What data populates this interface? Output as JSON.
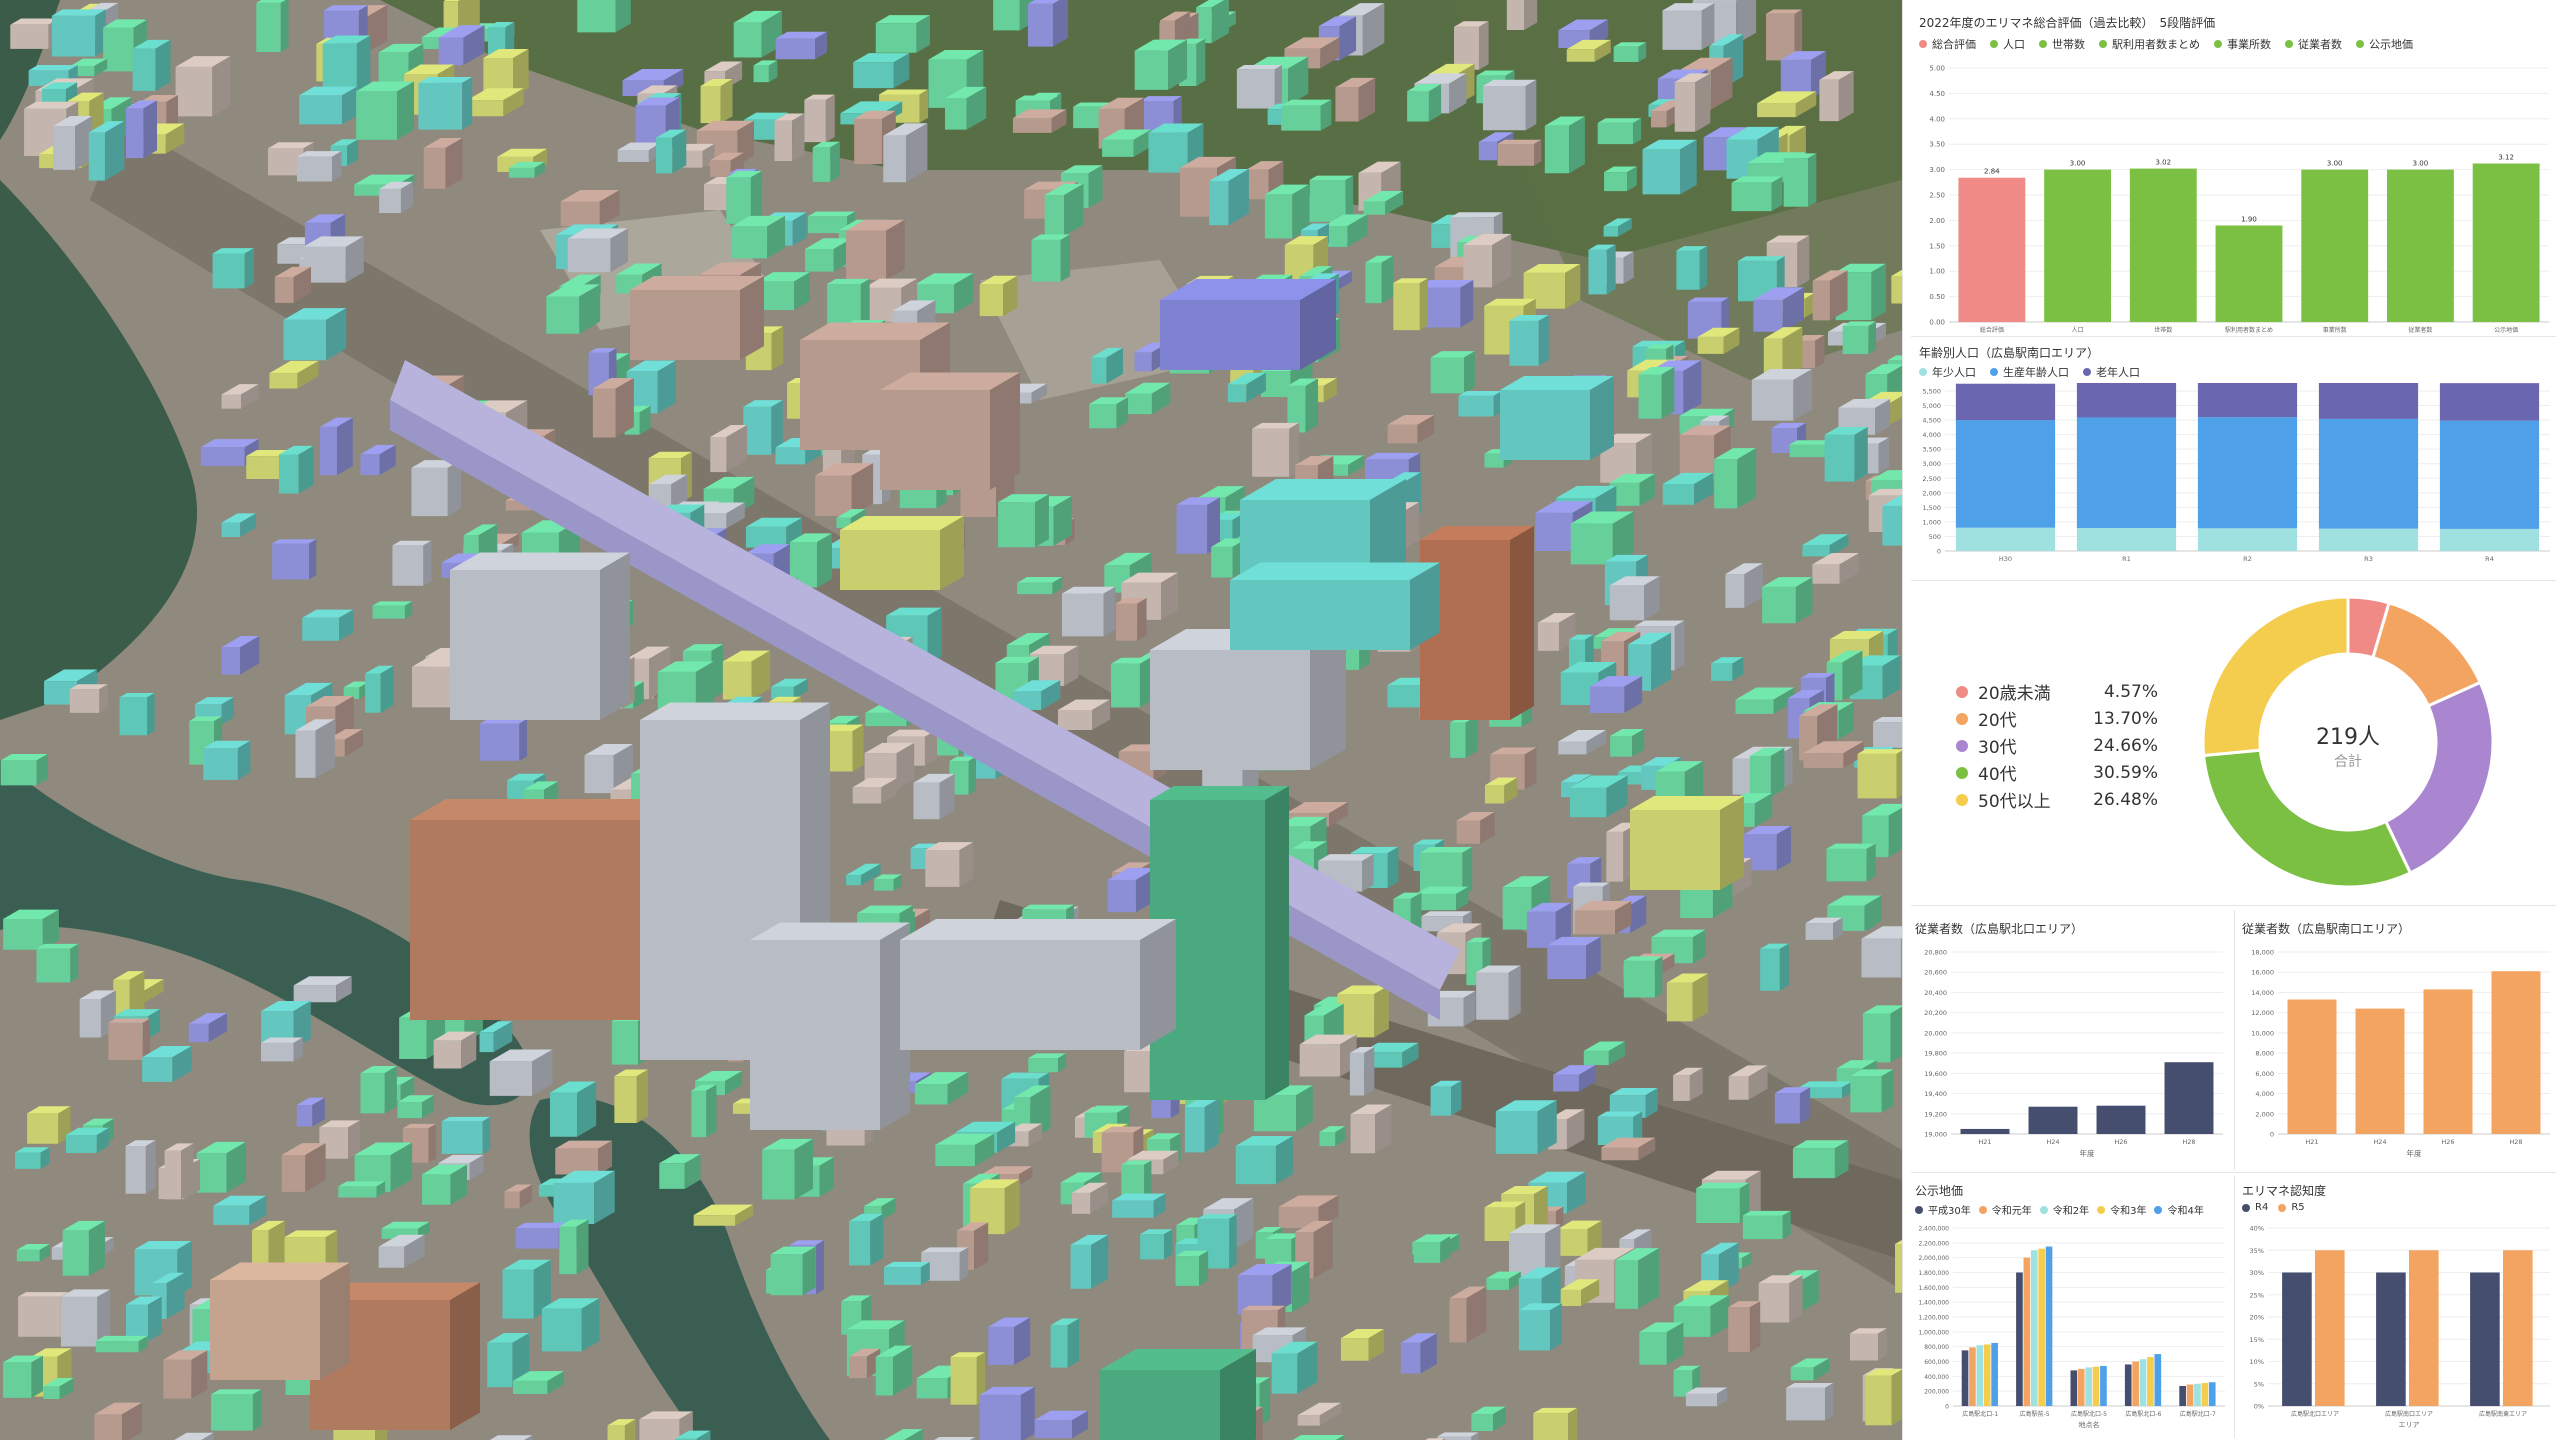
{
  "colors": {
    "green": "#7bc043",
    "salmon": "#ef8a87",
    "darkPurple": "#6a67b0",
    "blue": "#4ea0e8",
    "teal": "#9fe0e0",
    "navy": "#454e6e",
    "orange": "#f4a461",
    "yellow": "#f5cd4e",
    "purple": "#a986cf",
    "pink": "#ef8a87"
  },
  "map": {
    "description_icon": "3d-city-map"
  },
  "panel1": {
    "title": "2022年度のエリマネ総合評価（過去比較）　5段階評価",
    "legend": [
      {
        "label": "総合評価",
        "color": "#ef8a87"
      },
      {
        "label": "人口",
        "color": "#7bc043"
      },
      {
        "label": "世帯数",
        "color": "#7bc043"
      },
      {
        "label": "駅利用者数まとめ",
        "color": "#7bc043"
      },
      {
        "label": "事業所数",
        "color": "#7bc043"
      },
      {
        "label": "従業者数",
        "color": "#7bc043"
      },
      {
        "label": "公示地価",
        "color": "#7bc043"
      }
    ]
  },
  "panel2": {
    "title": "年齢別人口（広島駅南口エリア）",
    "legend": [
      {
        "label": "年少人口",
        "color": "#9fe0e0"
      },
      {
        "label": "生産年齢人口",
        "color": "#4ea0e8"
      },
      {
        "label": "老年人口",
        "color": "#6a67b0"
      }
    ]
  },
  "panel3": {
    "center_value": "219人",
    "center_label": "合計",
    "items": [
      {
        "label": "20歳未満",
        "pct": "4.57%",
        "color": "#ef8a87"
      },
      {
        "label": "20代",
        "pct": "13.70%",
        "color": "#f4a461"
      },
      {
        "label": "30代",
        "pct": "24.66%",
        "color": "#a986cf"
      },
      {
        "label": "40代",
        "pct": "30.59%",
        "color": "#7bc043"
      },
      {
        "label": "50代以上",
        "pct": "26.48%",
        "color": "#f5cd4e"
      }
    ]
  },
  "panel4": {
    "title": "従業者数（広島駅北口エリア）"
  },
  "panel5": {
    "title": "従業者数（広島駅南口エリア）"
  },
  "panel6": {
    "title": "公示地価",
    "legend": [
      {
        "label": "平成30年",
        "color": "#454e6e"
      },
      {
        "label": "令和元年",
        "color": "#f4a461"
      },
      {
        "label": "令和2年",
        "color": "#9fe0e0"
      },
      {
        "label": "令和3年",
        "color": "#f5cd4e"
      },
      {
        "label": "令和4年",
        "color": "#4ea0e8"
      }
    ]
  },
  "panel7": {
    "title": "エリマネ認知度",
    "legend": [
      {
        "label": "R4",
        "color": "#454e6e"
      },
      {
        "label": "R5",
        "color": "#f4a461"
      }
    ]
  },
  "chart_data": [
    {
      "type": "bar",
      "id": "overall-eval",
      "categories": [
        "総合評価",
        "人口",
        "世帯数",
        "駅利用者数まとめ",
        "事業所数",
        "従業者数",
        "公示地価"
      ],
      "values": [
        2.84,
        3.0,
        3.02,
        1.9,
        3.0,
        3.0,
        3.12
      ],
      "value_labels": [
        "2.84",
        "3.00",
        "3.02",
        "1.90",
        "3.00",
        "3.00",
        "3.12"
      ],
      "colors": [
        "#ef8a87",
        "#7bc043",
        "#7bc043",
        "#7bc043",
        "#7bc043",
        "#7bc043",
        "#7bc043"
      ],
      "ylim": [
        0,
        5
      ],
      "yticks": [
        "0.00",
        "0.50",
        "1.00",
        "1.50",
        "2.00",
        "2.50",
        "3.00",
        "3.50",
        "4.00",
        "4.50",
        "5.00"
      ]
    },
    {
      "type": "bar",
      "id": "age-population",
      "stacked": true,
      "categories": [
        "H30",
        "R1",
        "R2",
        "R3",
        "R4"
      ],
      "series": [
        {
          "name": "年少人口",
          "color": "#9fe0e0",
          "values": [
            800,
            790,
            780,
            770,
            760
          ]
        },
        {
          "name": "生産年齢人口",
          "color": "#4ea0e8",
          "values": [
            3700,
            3800,
            3820,
            3770,
            3720
          ]
        },
        {
          "name": "老年人口",
          "color": "#6a67b0",
          "values": [
            1250,
            1320,
            1310,
            1300,
            1290
          ]
        }
      ],
      "ylim": [
        0,
        5500
      ],
      "yticks": [
        "0",
        "500",
        "1,000",
        "1,500",
        "2,000",
        "2,500",
        "3,000",
        "3,500",
        "4,000",
        "4,500",
        "5,000",
        "5,500"
      ]
    },
    {
      "type": "pie",
      "id": "age-donut",
      "labels": [
        "20歳未満",
        "20代",
        "30代",
        "40代",
        "50代以上"
      ],
      "values": [
        4.57,
        13.7,
        24.66,
        30.59,
        26.48
      ],
      "colors": [
        "#ef8a87",
        "#f4a461",
        "#a986cf",
        "#7bc043",
        "#f5cd4e"
      ],
      "total": "219人"
    },
    {
      "type": "bar",
      "id": "employees-north",
      "categories": [
        "H21",
        "H24",
        "H26",
        "H28"
      ],
      "values": [
        19050,
        19270,
        19280,
        19710
      ],
      "color": "#454e6e",
      "xlabel": "年度",
      "ylim": [
        19000,
        20800
      ],
      "yticks": [
        "19,000",
        "19,200",
        "19,400",
        "19,600",
        "19,800",
        "20,000",
        "20,200",
        "20,400",
        "20,600",
        "20,800"
      ]
    },
    {
      "type": "bar",
      "id": "employees-south",
      "categories": [
        "H21",
        "H24",
        "H26",
        "H28"
      ],
      "values": [
        13300,
        12400,
        14300,
        16100
      ],
      "color": "#f4a461",
      "xlabel": "年度",
      "ylim": [
        0,
        18000
      ],
      "yticks": [
        "0",
        "2,000",
        "4,000",
        "6,000",
        "8,000",
        "10,000",
        "12,000",
        "14,000",
        "16,000",
        "18,000"
      ]
    },
    {
      "type": "bar",
      "id": "land-price",
      "categories": [
        "広島駅北口-1",
        "広島駅前-5",
        "広島駅北口-5",
        "広島駅北口-6",
        "広島駅北口-7"
      ],
      "series": [
        {
          "name": "平成30年",
          "color": "#454e6e",
          "values": [
            750000,
            1800000,
            480000,
            560000,
            270000
          ]
        },
        {
          "name": "令和元年",
          "color": "#f4a461",
          "values": [
            790000,
            2000000,
            500000,
            600000,
            290000
          ]
        },
        {
          "name": "令和2年",
          "color": "#9fe0e0",
          "values": [
            820000,
            2100000,
            520000,
            630000,
            300000
          ]
        },
        {
          "name": "令和3年",
          "color": "#f5cd4e",
          "values": [
            830000,
            2120000,
            530000,
            660000,
            310000
          ]
        },
        {
          "name": "令和4年",
          "color": "#4ea0e8",
          "values": [
            850000,
            2150000,
            540000,
            700000,
            320000
          ]
        }
      ],
      "xlabel": "地点名",
      "ylim": [
        0,
        2400000
      ],
      "yticks": [
        "0",
        "200,000",
        "400,000",
        "600,000",
        "800,000",
        "1,000,000",
        "1,200,000",
        "1,400,000",
        "1,600,000",
        "1,800,000",
        "2,000,000",
        "2,200,000",
        "2,400,000"
      ]
    },
    {
      "type": "bar",
      "id": "awareness",
      "categories": [
        "広島駅北口エリア",
        "広島駅南口エリア",
        "広島駅南東エリア"
      ],
      "series": [
        {
          "name": "R4",
          "color": "#454e6e",
          "values": [
            30,
            30,
            30
          ]
        },
        {
          "name": "R5",
          "color": "#f4a461",
          "values": [
            35,
            35,
            35
          ]
        }
      ],
      "xlabel": "エリア",
      "ylim": [
        0,
        40
      ],
      "yticks": [
        "0%",
        "5%",
        "10%",
        "15%",
        "20%",
        "25%",
        "30%",
        "35%",
        "40%"
      ]
    }
  ]
}
